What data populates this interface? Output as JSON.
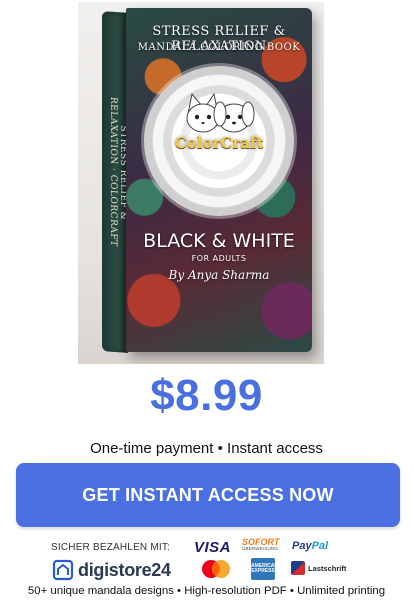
{
  "product": {
    "cover": {
      "title_line_1": "STRESS RELIEF & RELAXATION",
      "title_line_2": "MANDALA COLORING BOOK",
      "brand": "ColorCraft",
      "subtitle": "BLACK & WHITE",
      "audience": "FOR ADULTS",
      "author": "By Anya Sharma",
      "spine_text": "STRESS RELIEF & RELAXATION · COLORCRAFT"
    }
  },
  "price": "$8.99",
  "payment_note": "One-time payment • Instant access",
  "cta": {
    "label": "GET INSTANT ACCESS NOW"
  },
  "payment_methods": {
    "label": "SICHER BEZAHLEN MIT:",
    "visa": "VISA",
    "sofort": "SOFORT",
    "sofort_sub": "ÜBERWEISUNG",
    "paypal_part_1": "Pay",
    "paypal_part_2": "Pal",
    "digistore": "digistore24",
    "amex_line_1": "AMERICAN",
    "amex_line_2": "EXPRESS",
    "lastschrift": "Lastschrift"
  },
  "features": "50+ unique mandala designs • High-resolution PDF • Unlimited printing",
  "colors": {
    "accent": "#4a6fe0",
    "button_text": "#ffffff"
  }
}
